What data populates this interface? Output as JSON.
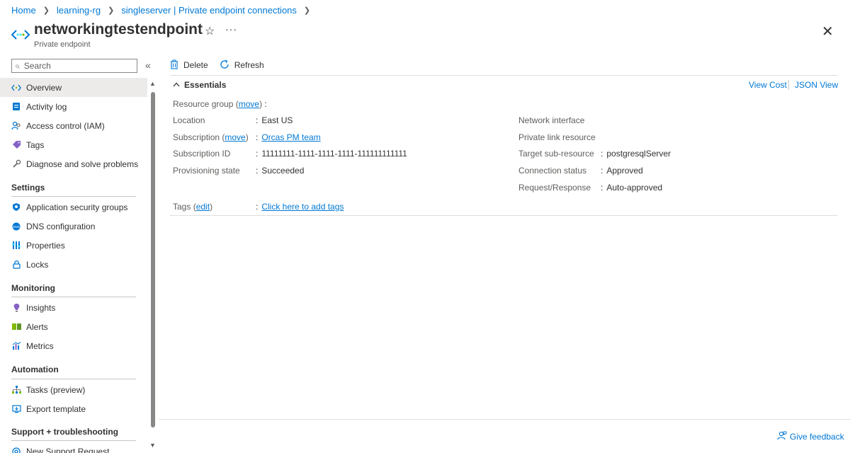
{
  "breadcrumb": {
    "items": [
      "Home",
      "learning-rg",
      "singleserver | Private endpoint connections"
    ],
    "separator": ">"
  },
  "header": {
    "title": "networkingtestendpoint",
    "subtitle": "Private endpoint",
    "icon": "private-endpoint-icon",
    "star": "☆",
    "more": "···",
    "close": "✕"
  },
  "search": {
    "placeholder": "Search"
  },
  "sidebar": {
    "collapse": "«",
    "items": [
      {
        "label": "Overview",
        "icon": "overview-icon",
        "active": true
      },
      {
        "label": "Activity log",
        "icon": "activity-log-icon"
      },
      {
        "label": "Access control (IAM)",
        "icon": "iam-icon"
      },
      {
        "label": "Tags",
        "icon": "tag-icon"
      },
      {
        "label": "Diagnose and solve problems",
        "icon": "wrench-icon"
      }
    ],
    "sections": [
      {
        "title": "Settings",
        "items": [
          {
            "label": "Application security groups",
            "icon": "shield-icon"
          },
          {
            "label": "DNS configuration",
            "icon": "dns-icon"
          },
          {
            "label": "Properties",
            "icon": "properties-icon"
          },
          {
            "label": "Locks",
            "icon": "lock-icon"
          }
        ]
      },
      {
        "title": "Monitoring",
        "items": [
          {
            "label": "Insights",
            "icon": "insights-icon"
          },
          {
            "label": "Alerts",
            "icon": "alerts-icon"
          },
          {
            "label": "Metrics",
            "icon": "metrics-icon"
          }
        ]
      },
      {
        "title": "Automation",
        "items": [
          {
            "label": "Tasks (preview)",
            "icon": "tasks-icon"
          },
          {
            "label": "Export template",
            "icon": "export-template-icon"
          }
        ]
      },
      {
        "title": "Support + troubleshooting",
        "items": [
          {
            "label": "New Support Request",
            "icon": "support-icon"
          }
        ]
      }
    ]
  },
  "toolbar": {
    "delete_label": "Delete",
    "refresh_label": "Refresh"
  },
  "essentials": {
    "title": "Essentials",
    "view_cost": "View Cost",
    "json_view": "JSON View",
    "left": {
      "resource_group_label": "Resource group",
      "resource_group_move": "move",
      "resource_group_value": "",
      "location_label": "Location",
      "location_value": "East US",
      "subscription_label": "Subscription",
      "subscription_move": "move",
      "subscription_value": "Orcas PM team",
      "subscription_id_label": "Subscription ID",
      "subscription_id_value": "11111111-1111-1111-1111-111111111111",
      "provisioning_state_label": "Provisioning state",
      "provisioning_state_value": "Succeeded"
    },
    "right": {
      "network_interface_label": "Network interface",
      "private_link_resource_label": "Private link resource",
      "target_sub_resource_label": "Target sub-resource",
      "target_sub_resource_value": "postgresqlServer",
      "connection_status_label": "Connection status",
      "connection_status_value": "Approved",
      "request_response_label": "Request/Response",
      "request_response_value": "Auto-approved"
    },
    "tags_label": "Tags",
    "tags_edit": "edit",
    "tags_value": "Click here to add tags",
    "colon": ":"
  },
  "footer": {
    "feedback": "Give feedback"
  },
  "colors": {
    "accent": "#0078d4",
    "text": "#323130",
    "muted": "#605e5c"
  }
}
